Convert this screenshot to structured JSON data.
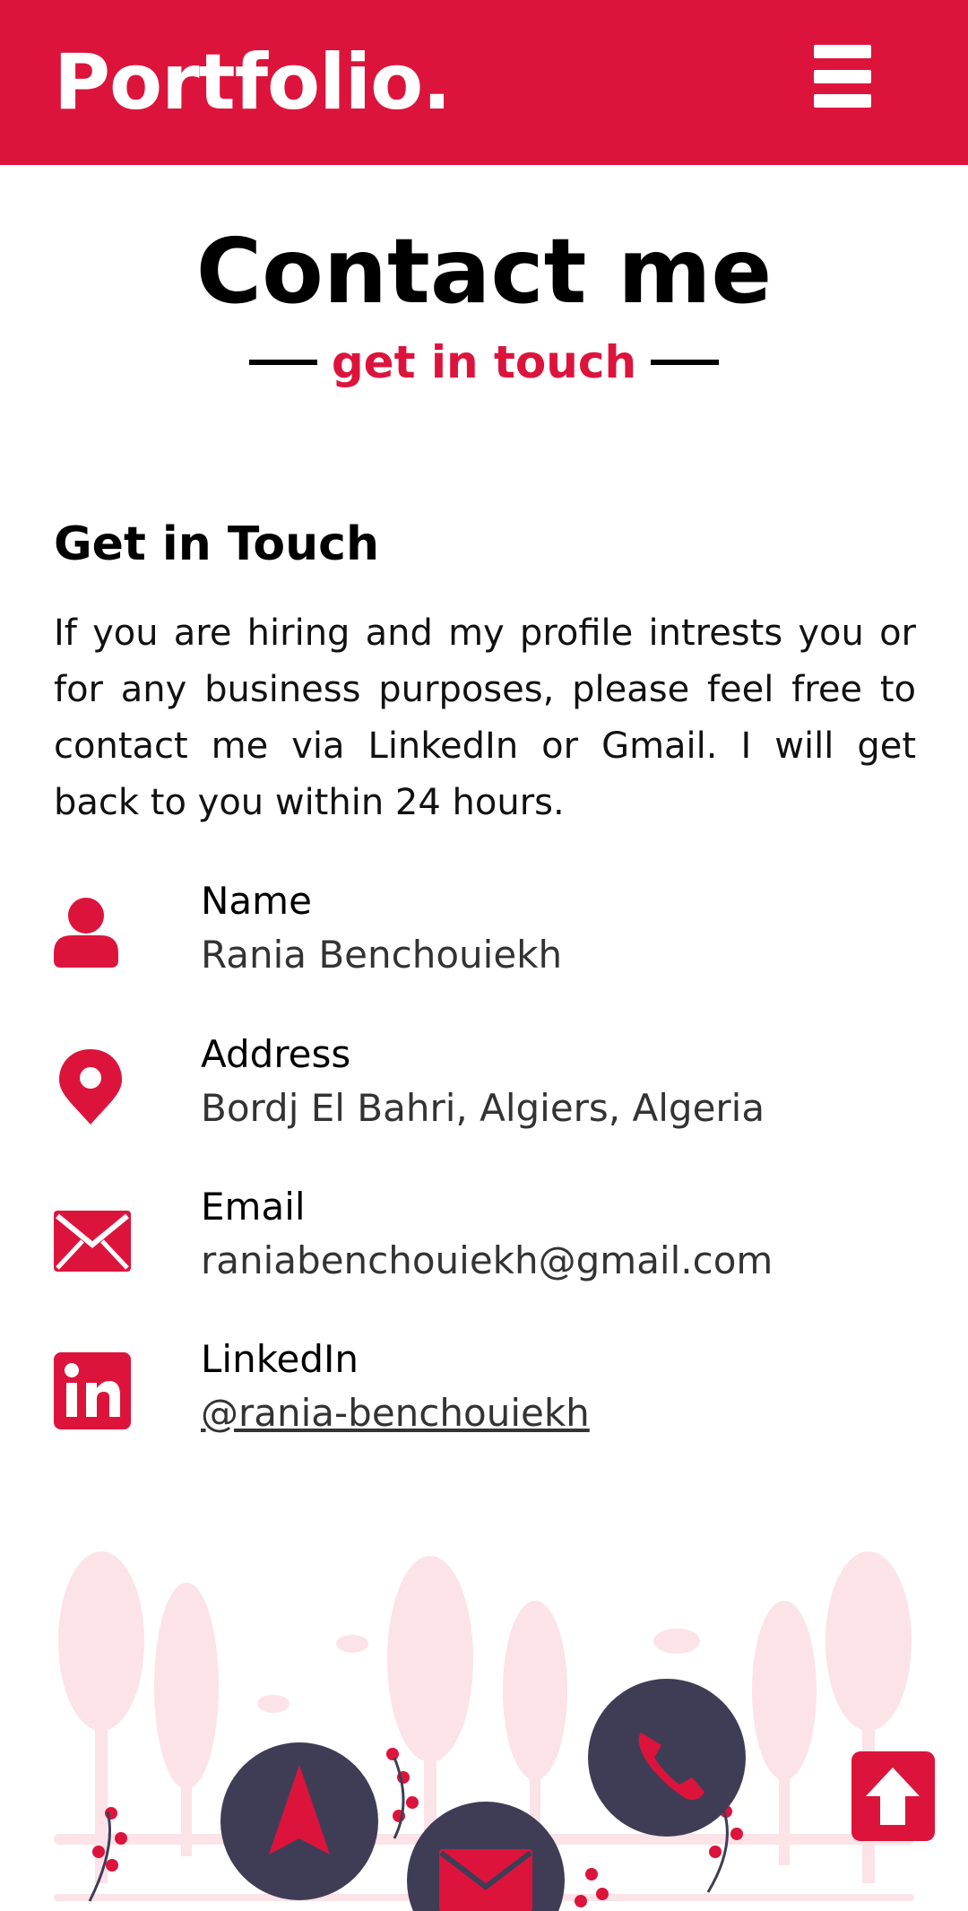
{
  "navbar": {
    "brand": "Portfolio.",
    "menu_icon": "hamburger-icon"
  },
  "contact": {
    "title": "Contact me",
    "subtitle": "get in touch",
    "heading": "Get in Touch",
    "intro": "If you are hiring and my profile intrests you or for any business purposes, please feel free to contact me via LinkedIn or Gmail. I will get back to you within 24 hours.",
    "items": [
      {
        "icon": "user-icon",
        "label": "Name",
        "value": "Rania Benchouiekh"
      },
      {
        "icon": "map-pin-icon",
        "label": "Address",
        "value": "Bordj El Bahri, Algiers, Algeria"
      },
      {
        "icon": "envelope-icon",
        "label": "Email",
        "value": "raniabenchouiekh@gmail.com"
      },
      {
        "icon": "linkedin-icon",
        "label": "LinkedIn",
        "value": "@rania-benchouiekh"
      }
    ]
  },
  "scroll_top": {
    "icon": "arrow-up-icon"
  },
  "colors": {
    "accent": "#dc143c",
    "dark_circle": "#3f3d56",
    "tree_pink": "#fbe3e8"
  }
}
